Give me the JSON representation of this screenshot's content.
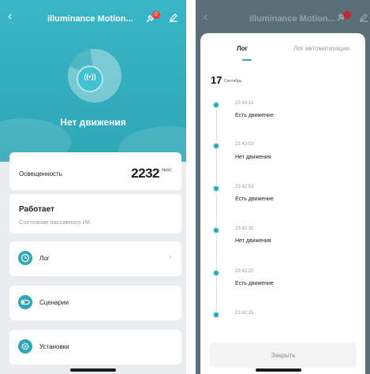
{
  "device": {
    "title": "illuminance Motion...",
    "notification_count": "0",
    "status": "Нет движения",
    "accent_color": "#2ea6b6"
  },
  "illuminance": {
    "label": "Освещенность",
    "value": "2232",
    "unit": "люкс"
  },
  "pir": {
    "title": "Работает",
    "subtitle": "Состояние пассивного ИК"
  },
  "menu": {
    "log": {
      "label": "Лог",
      "icon": "clock-icon"
    },
    "scenes": {
      "label": "Сценарии",
      "icon": "toggle-icon"
    },
    "settings": {
      "label": "Установки",
      "icon": "gear-icon"
    }
  },
  "log_sheet": {
    "tabs": {
      "log": "Лог",
      "automation": "Лог автоматизации"
    },
    "date_day": "17",
    "date_month": "Сентябрь",
    "events": [
      {
        "time": "23:43:10",
        "text": "Есть движение"
      },
      {
        "time": "23:43:03",
        "text": "Нет движения"
      },
      {
        "time": "23:42:53",
        "text": "Есть движение"
      },
      {
        "time": "23:42:30",
        "text": "Нет движения"
      },
      {
        "time": "23:42:20",
        "text": "Есть движение"
      },
      {
        "time": "23:42:15",
        "text": ""
      }
    ],
    "close_label": "Закрыть"
  }
}
